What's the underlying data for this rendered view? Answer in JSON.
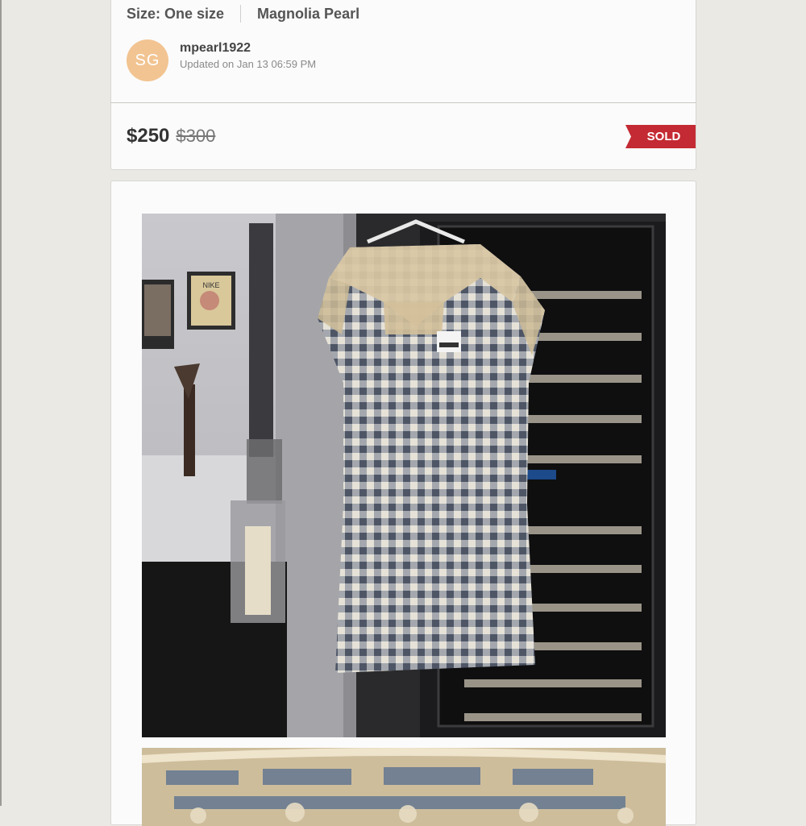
{
  "listing": {
    "size_text": "Size: One size",
    "brand": "Magnolia Pearl"
  },
  "seller": {
    "initials": "SG",
    "username": "mpearl1922",
    "updated": "Updated on Jan 13 06:59 PM",
    "avatar_color": "#f2c491"
  },
  "price": {
    "current": "$250",
    "original": "$300",
    "status": "SOLD",
    "status_color": "#c42a33"
  },
  "photo": {
    "poster_text": "NIKE"
  }
}
